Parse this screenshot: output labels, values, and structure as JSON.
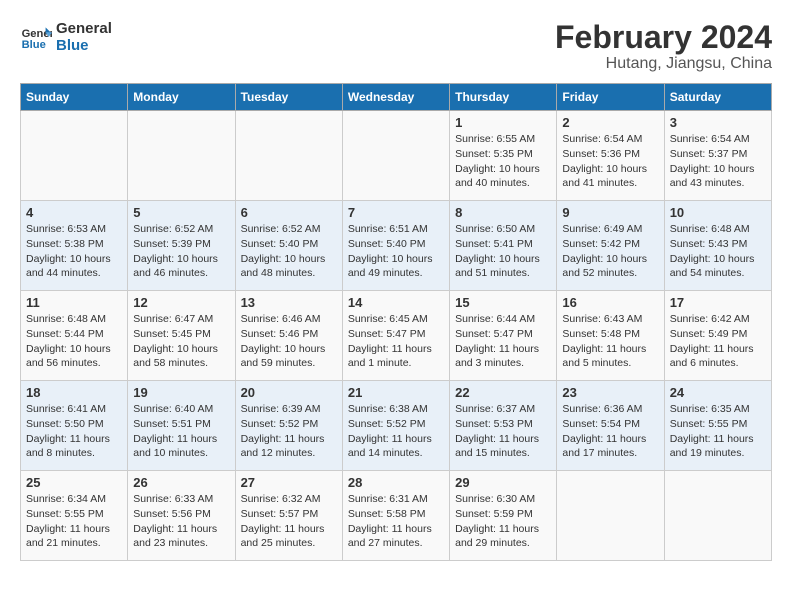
{
  "logo": {
    "line1": "General",
    "line2": "Blue"
  },
  "title": "February 2024",
  "subtitle": "Hutang, Jiangsu, China",
  "weekdays": [
    "Sunday",
    "Monday",
    "Tuesday",
    "Wednesday",
    "Thursday",
    "Friday",
    "Saturday"
  ],
  "weeks": [
    [
      {
        "day": "",
        "info": ""
      },
      {
        "day": "",
        "info": ""
      },
      {
        "day": "",
        "info": ""
      },
      {
        "day": "",
        "info": ""
      },
      {
        "day": "1",
        "info": "Sunrise: 6:55 AM\nSunset: 5:35 PM\nDaylight: 10 hours\nand 40 minutes."
      },
      {
        "day": "2",
        "info": "Sunrise: 6:54 AM\nSunset: 5:36 PM\nDaylight: 10 hours\nand 41 minutes."
      },
      {
        "day": "3",
        "info": "Sunrise: 6:54 AM\nSunset: 5:37 PM\nDaylight: 10 hours\nand 43 minutes."
      }
    ],
    [
      {
        "day": "4",
        "info": "Sunrise: 6:53 AM\nSunset: 5:38 PM\nDaylight: 10 hours\nand 44 minutes."
      },
      {
        "day": "5",
        "info": "Sunrise: 6:52 AM\nSunset: 5:39 PM\nDaylight: 10 hours\nand 46 minutes."
      },
      {
        "day": "6",
        "info": "Sunrise: 6:52 AM\nSunset: 5:40 PM\nDaylight: 10 hours\nand 48 minutes."
      },
      {
        "day": "7",
        "info": "Sunrise: 6:51 AM\nSunset: 5:40 PM\nDaylight: 10 hours\nand 49 minutes."
      },
      {
        "day": "8",
        "info": "Sunrise: 6:50 AM\nSunset: 5:41 PM\nDaylight: 10 hours\nand 51 minutes."
      },
      {
        "day": "9",
        "info": "Sunrise: 6:49 AM\nSunset: 5:42 PM\nDaylight: 10 hours\nand 52 minutes."
      },
      {
        "day": "10",
        "info": "Sunrise: 6:48 AM\nSunset: 5:43 PM\nDaylight: 10 hours\nand 54 minutes."
      }
    ],
    [
      {
        "day": "11",
        "info": "Sunrise: 6:48 AM\nSunset: 5:44 PM\nDaylight: 10 hours\nand 56 minutes."
      },
      {
        "day": "12",
        "info": "Sunrise: 6:47 AM\nSunset: 5:45 PM\nDaylight: 10 hours\nand 58 minutes."
      },
      {
        "day": "13",
        "info": "Sunrise: 6:46 AM\nSunset: 5:46 PM\nDaylight: 10 hours\nand 59 minutes."
      },
      {
        "day": "14",
        "info": "Sunrise: 6:45 AM\nSunset: 5:47 PM\nDaylight: 11 hours\nand 1 minute."
      },
      {
        "day": "15",
        "info": "Sunrise: 6:44 AM\nSunset: 5:47 PM\nDaylight: 11 hours\nand 3 minutes."
      },
      {
        "day": "16",
        "info": "Sunrise: 6:43 AM\nSunset: 5:48 PM\nDaylight: 11 hours\nand 5 minutes."
      },
      {
        "day": "17",
        "info": "Sunrise: 6:42 AM\nSunset: 5:49 PM\nDaylight: 11 hours\nand 6 minutes."
      }
    ],
    [
      {
        "day": "18",
        "info": "Sunrise: 6:41 AM\nSunset: 5:50 PM\nDaylight: 11 hours\nand 8 minutes."
      },
      {
        "day": "19",
        "info": "Sunrise: 6:40 AM\nSunset: 5:51 PM\nDaylight: 11 hours\nand 10 minutes."
      },
      {
        "day": "20",
        "info": "Sunrise: 6:39 AM\nSunset: 5:52 PM\nDaylight: 11 hours\nand 12 minutes."
      },
      {
        "day": "21",
        "info": "Sunrise: 6:38 AM\nSunset: 5:52 PM\nDaylight: 11 hours\nand 14 minutes."
      },
      {
        "day": "22",
        "info": "Sunrise: 6:37 AM\nSunset: 5:53 PM\nDaylight: 11 hours\nand 15 minutes."
      },
      {
        "day": "23",
        "info": "Sunrise: 6:36 AM\nSunset: 5:54 PM\nDaylight: 11 hours\nand 17 minutes."
      },
      {
        "day": "24",
        "info": "Sunrise: 6:35 AM\nSunset: 5:55 PM\nDaylight: 11 hours\nand 19 minutes."
      }
    ],
    [
      {
        "day": "25",
        "info": "Sunrise: 6:34 AM\nSunset: 5:55 PM\nDaylight: 11 hours\nand 21 minutes."
      },
      {
        "day": "26",
        "info": "Sunrise: 6:33 AM\nSunset: 5:56 PM\nDaylight: 11 hours\nand 23 minutes."
      },
      {
        "day": "27",
        "info": "Sunrise: 6:32 AM\nSunset: 5:57 PM\nDaylight: 11 hours\nand 25 minutes."
      },
      {
        "day": "28",
        "info": "Sunrise: 6:31 AM\nSunset: 5:58 PM\nDaylight: 11 hours\nand 27 minutes."
      },
      {
        "day": "29",
        "info": "Sunrise: 6:30 AM\nSunset: 5:59 PM\nDaylight: 11 hours\nand 29 minutes."
      },
      {
        "day": "",
        "info": ""
      },
      {
        "day": "",
        "info": ""
      }
    ]
  ]
}
